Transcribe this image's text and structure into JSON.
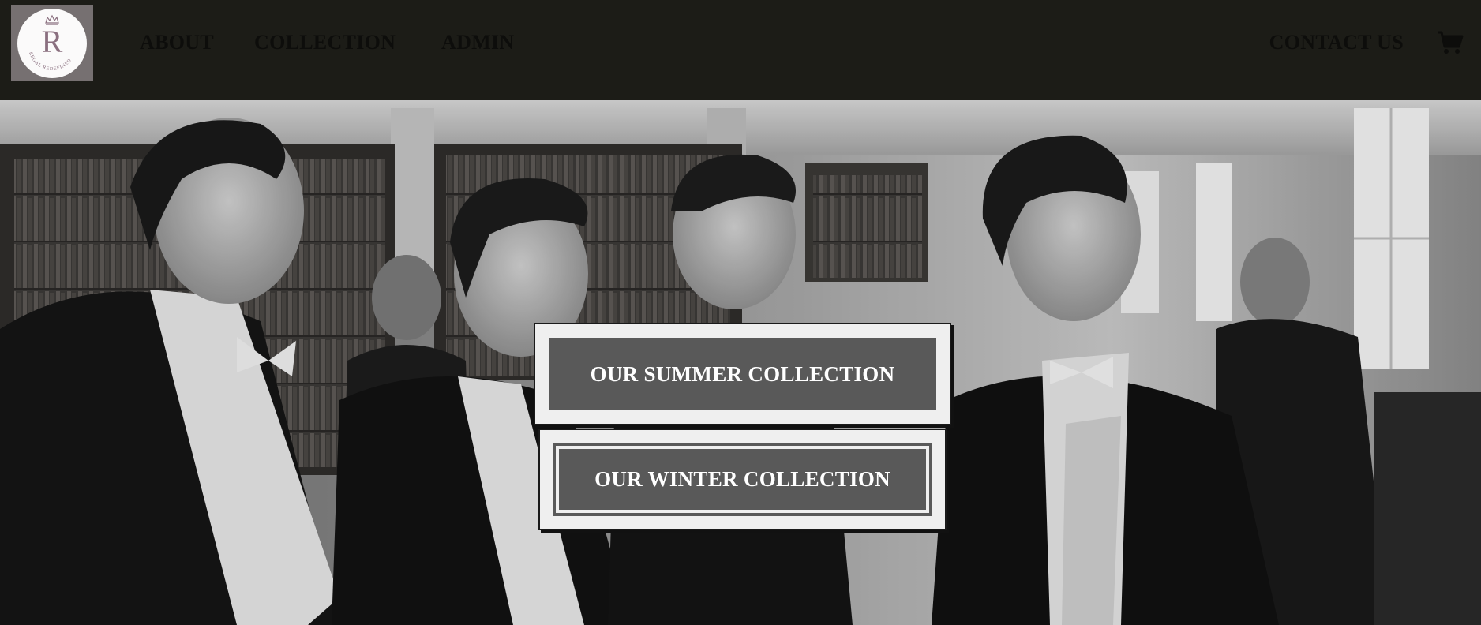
{
  "brand": {
    "logo_letter": "R",
    "logo_ring_text": "REGAL REDEFINED",
    "logo_icon": "crown-icon"
  },
  "nav": {
    "about": "ABOUT",
    "collection": "COLLECTION",
    "admin": "ADMIN",
    "contact": "CONTACT US",
    "cart_icon": "shopping-cart-icon"
  },
  "hero": {
    "image_icon": "vintage-tuxedo-photo",
    "summer_button": "OUR SUMMER COLLECTION",
    "winter_button": "OUR WINTER COLLECTION"
  },
  "colors": {
    "navbar_bg": "#1c1c17",
    "nav_text": "#0d0d0b",
    "button_fill": "#595959",
    "button_frame": "#efefef",
    "logo_accent": "#8a6f7f"
  }
}
